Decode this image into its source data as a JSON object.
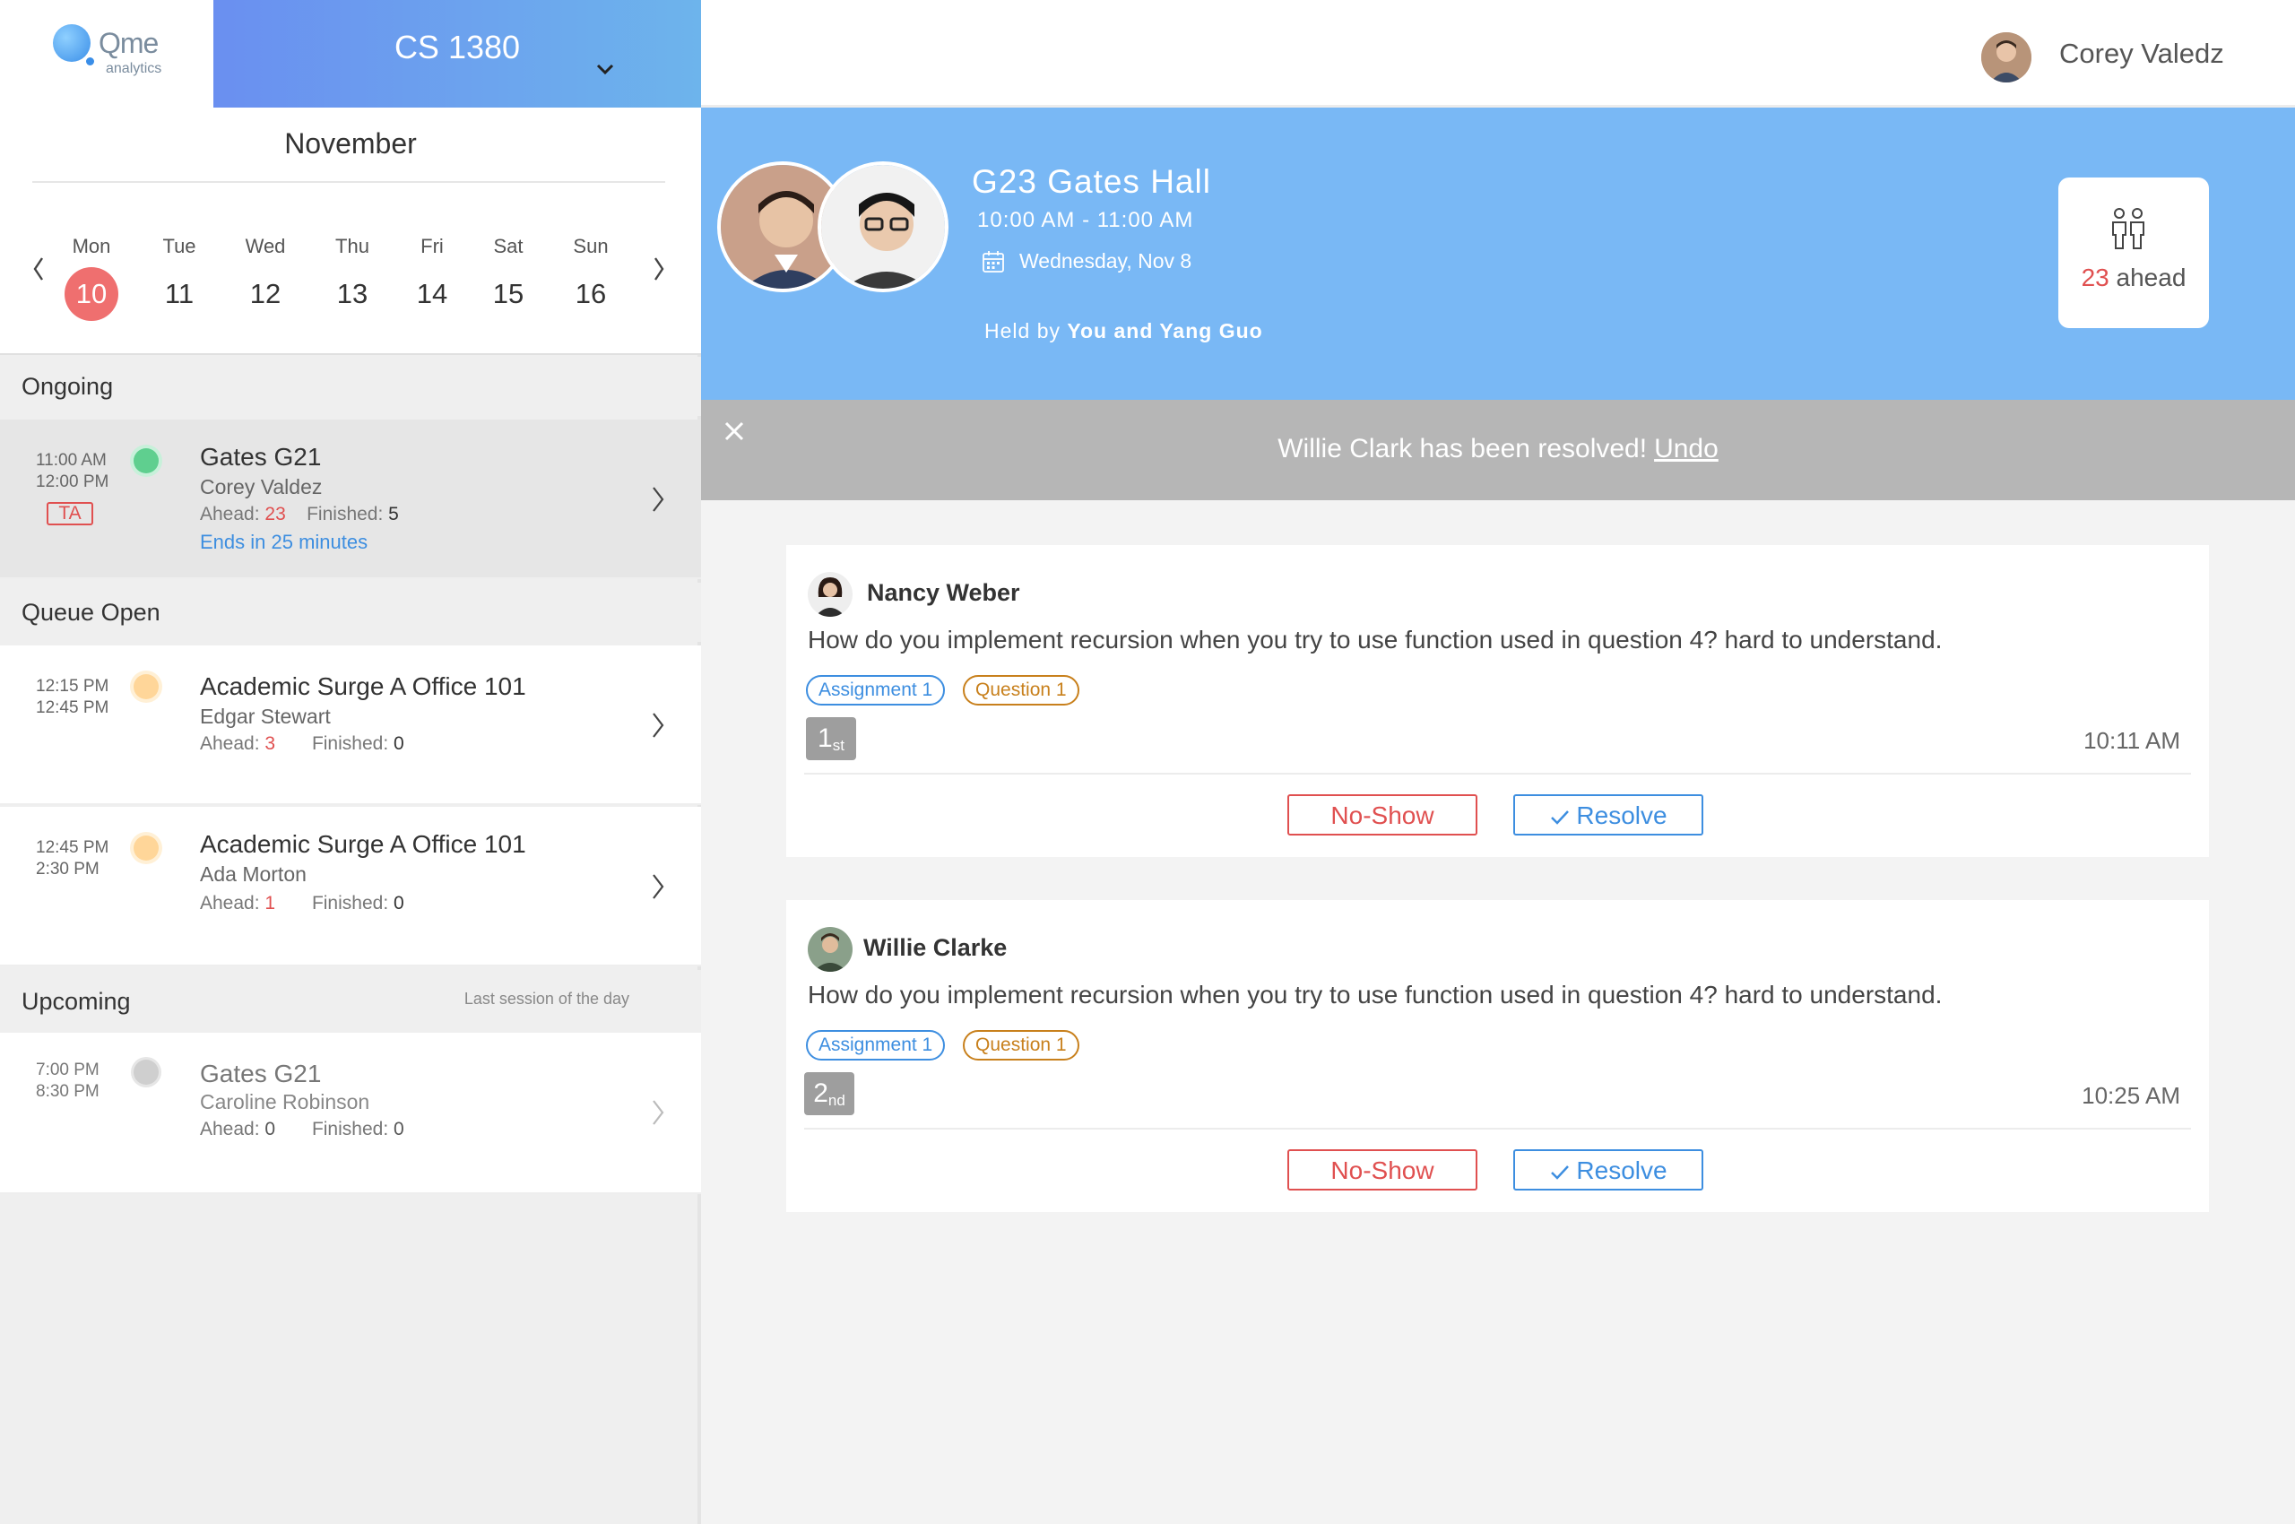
{
  "brand": {
    "logo_text": "Qme",
    "logo_sub": "analytics"
  },
  "course": {
    "name": "CS 1380"
  },
  "calendar": {
    "month": "November",
    "days": [
      {
        "name": "Mon",
        "num": "10",
        "selected": true
      },
      {
        "name": "Tue",
        "num": "11"
      },
      {
        "name": "Wed",
        "num": "12"
      },
      {
        "name": "Thu",
        "num": "13"
      },
      {
        "name": "Fri",
        "num": "14"
      },
      {
        "name": "Sat",
        "num": "15"
      },
      {
        "name": "Sun",
        "num": "16"
      }
    ]
  },
  "sections": {
    "ongoing": "Ongoing",
    "queue_open": "Queue Open",
    "upcoming": "Upcoming",
    "upcoming_note": "Last session of the day"
  },
  "sessions": [
    {
      "start": "11:00 AM",
      "end": "12:00 PM",
      "title": "Gates G21",
      "host": "Corey Valdez",
      "ahead_label": "Ahead:",
      "ahead": "23",
      "finished_label": "Finished:",
      "finished": "5",
      "ends": "Ends in 25 minutes",
      "badge": "TA",
      "status_color": "#5fcf8f"
    },
    {
      "start": "12:15 PM",
      "end": "12:45 PM",
      "title": "Academic Surge A Office 101",
      "host": "Edgar Stewart",
      "ahead_label": "Ahead:",
      "ahead": "3",
      "finished_label": "Finished:",
      "finished": "0",
      "status_color": "#ffd699"
    },
    {
      "start": "12:45 PM",
      "end": "2:30 PM",
      "title": "Academic Surge A Office 101",
      "host": "Ada Morton",
      "ahead_label": "Ahead:",
      "ahead": "1",
      "finished_label": "Finished:",
      "finished": "0",
      "status_color": "#ffd699"
    },
    {
      "start": "7:00 PM",
      "end": "8:30 PM",
      "title": "Gates G21",
      "host": "Caroline Robinson",
      "ahead_label": "Ahead:",
      "ahead": "0",
      "finished_label": "Finished:",
      "finished": "0",
      "status_color": "#cfcfcf"
    }
  ],
  "user": {
    "name": "Corey Valedz"
  },
  "hero": {
    "room": "G23 Gates Hall",
    "hours": "10:00 AM - 11:00 AM",
    "date": "Wednesday, Nov 8",
    "held_by_prefix": "Held by ",
    "held_by_names": "You and Yang Guo",
    "ahead_count": "23",
    "ahead_label": "ahead"
  },
  "toast": {
    "message": "Willie Clark has been resolved!",
    "undo": "Undo"
  },
  "queue": [
    {
      "name": "Nancy Weber",
      "question": "How do you implement recursion when you try to use function used in question 4? hard to  understand.",
      "tags": [
        "Assignment 1",
        "Question 1"
      ],
      "rank_num": "1",
      "rank_suffix": "st",
      "time": "10:11 AM",
      "noshow": "No-Show",
      "resolve": "Resolve"
    },
    {
      "name": "Willie Clarke",
      "question": "How do you implement recursion when you try to use function used in question 4? hard to  understand.",
      "tags": [
        "Assignment 1",
        "Question 1"
      ],
      "rank_num": "2",
      "rank_suffix": "nd",
      "time": "10:25 AM",
      "noshow": "No-Show",
      "resolve": "Resolve"
    }
  ],
  "colors": {
    "accent": "#79b8f5",
    "danger": "#e05050",
    "link": "#3d8ee0",
    "tag_orange": "#c8801c"
  }
}
